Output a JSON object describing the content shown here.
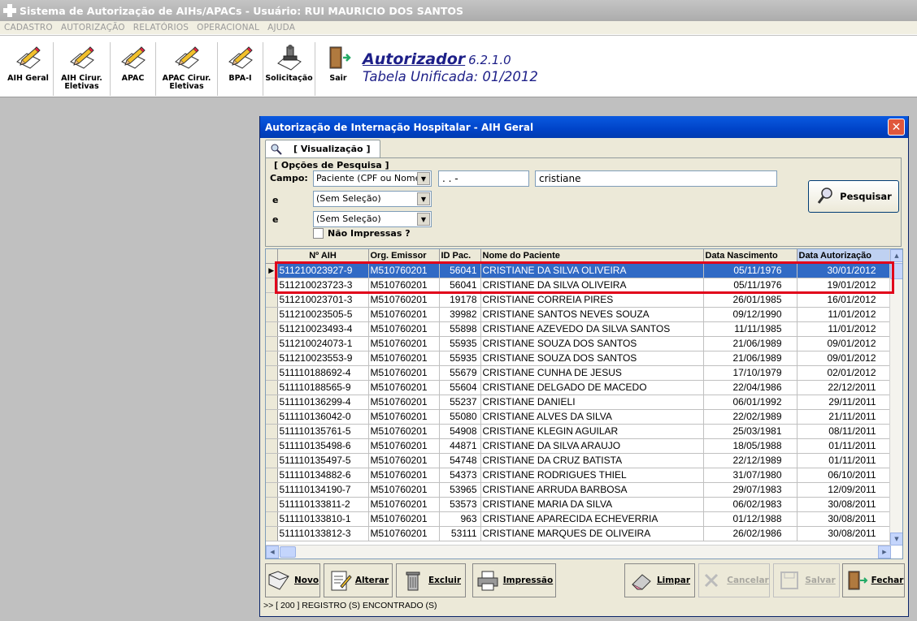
{
  "app": {
    "title": "Sistema de Autorização de AIHs/APACs - Usuário: RUI MAURICIO DOS SANTOS"
  },
  "menu": [
    "CADASTRO",
    "AUTORIZAÇÃO",
    "RELATÓRIOS",
    "OPERACIONAL",
    "AJUDA"
  ],
  "toolbar": {
    "aih_geral": "AIH Geral",
    "aih_cirur_1": "AIH Cirur.",
    "aih_cirur_2": "Eletivas",
    "apac": "APAC",
    "apac_cirur_1": "APAC Cirur.",
    "apac_cirur_2": "Eletivas",
    "bpa": "BPA-I",
    "solicitacao": "Solicitação",
    "sair": "Sair"
  },
  "brand": {
    "name": "Autorizador",
    "version": "6.2.1.0",
    "table": "Tabela Unificada: 01/2012"
  },
  "window": {
    "title": "Autorização de Internação Hospitalar - AIH Geral",
    "tab": "[ Visualização ]",
    "search_group": "[ Opções de Pesquisa ]",
    "campo_label": "Campo:",
    "e_label_1": "e",
    "e_label_2": "e",
    "campo_value": "Paciente (CPF ou Nome)",
    "cpf_value": "  .   .   -",
    "name_value": "cristiane",
    "filter1": "(Sem Seleção)",
    "filter2": "(Sem Seleção)",
    "nao_impressas": "Não Impressas ?",
    "pesquisar": "Pesquisar"
  },
  "grid": {
    "headers": [
      "Nº AIH",
      "Org. Emissor",
      "ID Pac.",
      "Nome do Paciente",
      "Data Nascimento",
      "Data Autorização"
    ],
    "rows": [
      [
        "511210023927-9",
        "M510760201",
        "56041",
        "CRISTIANE DA SILVA OLIVEIRA",
        "05/11/1976",
        "30/01/2012"
      ],
      [
        "511210023723-3",
        "M510760201",
        "56041",
        "CRISTIANE DA SILVA OLIVEIRA",
        "05/11/1976",
        "19/01/2012"
      ],
      [
        "511210023701-3",
        "M510760201",
        "19178",
        "CRISTIANE CORREIA PIRES",
        "26/01/1985",
        "16/01/2012"
      ],
      [
        "511210023505-5",
        "M510760201",
        "39982",
        "CRISTIANE SANTOS NEVES SOUZA",
        "09/12/1990",
        "11/01/2012"
      ],
      [
        "511210023493-4",
        "M510760201",
        "55898",
        "CRISTIANE AZEVEDO DA SILVA SANTOS",
        "11/11/1985",
        "11/01/2012"
      ],
      [
        "511210024073-1",
        "M510760201",
        "55935",
        "CRISTIANE SOUZA DOS SANTOS",
        "21/06/1989",
        "09/01/2012"
      ],
      [
        "511210023553-9",
        "M510760201",
        "55935",
        "CRISTIANE SOUZA DOS SANTOS",
        "21/06/1989",
        "09/01/2012"
      ],
      [
        "511110188692-4",
        "M510760201",
        "55679",
        "CRISTIANE CUNHA DE JESUS",
        "17/10/1979",
        "02/01/2012"
      ],
      [
        "511110188565-9",
        "M510760201",
        "55604",
        "CRISTIANE DELGADO DE MACEDO",
        "22/04/1986",
        "22/12/2011"
      ],
      [
        "511110136299-4",
        "M510760201",
        "55237",
        "CRISTIANE DANIELI",
        "06/01/1992",
        "29/11/2011"
      ],
      [
        "511110136042-0",
        "M510760201",
        "55080",
        "CRISTIANE ALVES DA SILVA",
        "22/02/1989",
        "21/11/2011"
      ],
      [
        "511110135761-5",
        "M510760201",
        "54908",
        "CRISTIANE KLEGIN AGUILAR",
        "25/03/1981",
        "08/11/2011"
      ],
      [
        "511110135498-6",
        "M510760201",
        "44871",
        "CRISTIANE DA SILVA ARAUJO",
        "18/05/1988",
        "01/11/2011"
      ],
      [
        "511110135497-5",
        "M510760201",
        "54748",
        "CRISTIANE DA CRUZ BATISTA",
        "22/12/1989",
        "01/11/2011"
      ],
      [
        "511110134882-6",
        "M510760201",
        "54373",
        "CRISTIANE RODRIGUES THIEL",
        "31/07/1980",
        "06/10/2011"
      ],
      [
        "511110134190-7",
        "M510760201",
        "53965",
        "CRISTIANE ARRUDA BARBOSA",
        "29/07/1983",
        "12/09/2011"
      ],
      [
        "511110133811-2",
        "M510760201",
        "53573",
        "CRISTIANE MARIA DA SILVA",
        "06/02/1983",
        "30/08/2011"
      ],
      [
        "511110133810-1",
        "M510760201",
        "963",
        "CRISTIANE APARECIDA ECHEVERRIA",
        "01/12/1988",
        "30/08/2011"
      ],
      [
        "511110133812-3",
        "M510760201",
        "53111",
        "CRISTIANE MARQUES DE OLIVEIRA",
        "26/02/1986",
        "30/08/2011"
      ]
    ]
  },
  "actions": {
    "novo": "Novo",
    "alterar": "Alterar",
    "excluir": "Excluir",
    "impressao": "Impressão",
    "limpar": "Limpar",
    "cancelar": "Cancelar",
    "salvar": "Salvar",
    "fechar": "Fechar"
  },
  "status": ">> [ 200 ] REGISTRO (S) ENCONTRADO (S)",
  "colors": {
    "selection": "#316ac5",
    "titlebar": "#0054e3",
    "highlight_box": "#e1001a",
    "brand": "#1d1f88"
  }
}
